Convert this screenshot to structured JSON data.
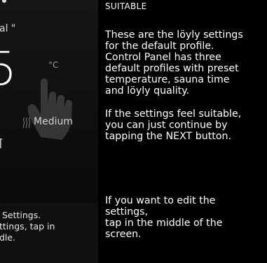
{
  "screen": {
    "profile_name": "al \"",
    "temperature_value": "5",
    "temperature_unit": "°C",
    "loyly_quality": "Medium",
    "hint": " Settings.\nttings, tap in\ndle."
  },
  "description": {
    "heading": "SUITABLE",
    "paragraph_1": "These are the löyly settings\nfor the default profile.\nControl Panel has three\ndefault profiles with preset\ntemperature, sauna time\nand löyly quality.",
    "paragraph_2": "If the settings feel suitable,\nyou can just continue by\ntapping the NEXT button.",
    "paragraph_3": "If you want to edit the\nsettings,\ntap in the middle of the\nscreen."
  },
  "icons": [
    "steam-icon",
    "hand-tap-icon",
    "clock-icon"
  ]
}
